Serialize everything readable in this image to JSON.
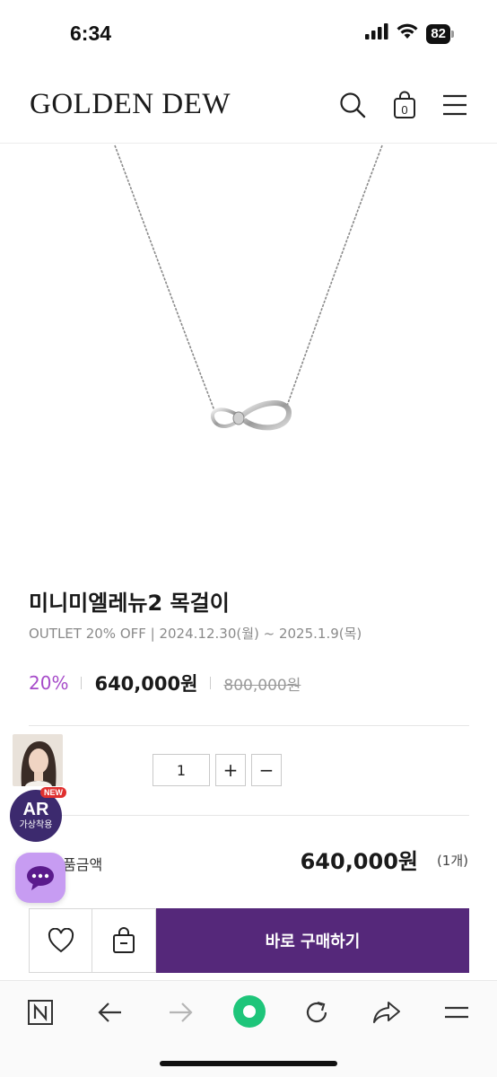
{
  "status_bar": {
    "time": "6:34",
    "battery": "82",
    "icons": [
      "cellular-signal-icon",
      "wifi-icon",
      "battery-icon"
    ]
  },
  "header": {
    "logo": "GOLDEN DEW",
    "icons": [
      "search-icon",
      "shopping-bag-icon",
      "menu-icon"
    ],
    "cart_count": "0"
  },
  "product": {
    "image": "necklace-image",
    "title": "미니미엘레뉴2 목걸이",
    "promo": "OUTLET 20% OFF | 2024.12.30(월) ~ 2025.1.9(목)",
    "discount": "20%",
    "sale_price": "640,000원",
    "original_price": "800,000원"
  },
  "quantity": {
    "value": "1",
    "plus": "+",
    "minus": "−"
  },
  "floating": {
    "ar_label": "AR",
    "ar_sub": "가상착용",
    "new_badge": "NEW",
    "chat_icon": "chat-bubble-icon"
  },
  "total": {
    "label": "총 상품금액",
    "label_visible": "품금액",
    "price": "640,000원",
    "count": "(1개)"
  },
  "actions": {
    "wishlist_icon": "heart-icon",
    "cart_icon": "shopping-bag-icon",
    "buy_label": "바로 구매하기"
  },
  "colors": {
    "accent": "#55287a",
    "discount": "#a64bc9",
    "chat_button": "#c79cf2",
    "browser_home": "#1ec57a"
  },
  "browser_toolbar": {
    "icons": [
      "naver-home-icon",
      "back-arrow-icon",
      "forward-arrow-icon",
      "green-dot-icon",
      "reload-icon",
      "share-icon",
      "menu-icon"
    ]
  }
}
